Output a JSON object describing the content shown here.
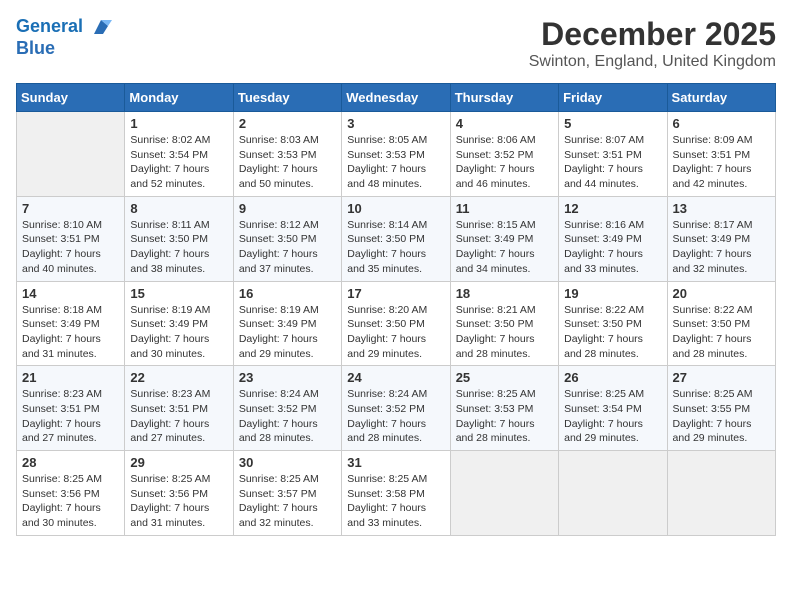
{
  "header": {
    "logo_line1": "General",
    "logo_line2": "Blue",
    "month": "December 2025",
    "location": "Swinton, England, United Kingdom"
  },
  "weekdays": [
    "Sunday",
    "Monday",
    "Tuesday",
    "Wednesday",
    "Thursday",
    "Friday",
    "Saturday"
  ],
  "weeks": [
    [
      {
        "day": "",
        "info": ""
      },
      {
        "day": "1",
        "info": "Sunrise: 8:02 AM\nSunset: 3:54 PM\nDaylight: 7 hours\nand 52 minutes."
      },
      {
        "day": "2",
        "info": "Sunrise: 8:03 AM\nSunset: 3:53 PM\nDaylight: 7 hours\nand 50 minutes."
      },
      {
        "day": "3",
        "info": "Sunrise: 8:05 AM\nSunset: 3:53 PM\nDaylight: 7 hours\nand 48 minutes."
      },
      {
        "day": "4",
        "info": "Sunrise: 8:06 AM\nSunset: 3:52 PM\nDaylight: 7 hours\nand 46 minutes."
      },
      {
        "day": "5",
        "info": "Sunrise: 8:07 AM\nSunset: 3:51 PM\nDaylight: 7 hours\nand 44 minutes."
      },
      {
        "day": "6",
        "info": "Sunrise: 8:09 AM\nSunset: 3:51 PM\nDaylight: 7 hours\nand 42 minutes."
      }
    ],
    [
      {
        "day": "7",
        "info": "Sunrise: 8:10 AM\nSunset: 3:51 PM\nDaylight: 7 hours\nand 40 minutes."
      },
      {
        "day": "8",
        "info": "Sunrise: 8:11 AM\nSunset: 3:50 PM\nDaylight: 7 hours\nand 38 minutes."
      },
      {
        "day": "9",
        "info": "Sunrise: 8:12 AM\nSunset: 3:50 PM\nDaylight: 7 hours\nand 37 minutes."
      },
      {
        "day": "10",
        "info": "Sunrise: 8:14 AM\nSunset: 3:50 PM\nDaylight: 7 hours\nand 35 minutes."
      },
      {
        "day": "11",
        "info": "Sunrise: 8:15 AM\nSunset: 3:49 PM\nDaylight: 7 hours\nand 34 minutes."
      },
      {
        "day": "12",
        "info": "Sunrise: 8:16 AM\nSunset: 3:49 PM\nDaylight: 7 hours\nand 33 minutes."
      },
      {
        "day": "13",
        "info": "Sunrise: 8:17 AM\nSunset: 3:49 PM\nDaylight: 7 hours\nand 32 minutes."
      }
    ],
    [
      {
        "day": "14",
        "info": "Sunrise: 8:18 AM\nSunset: 3:49 PM\nDaylight: 7 hours\nand 31 minutes."
      },
      {
        "day": "15",
        "info": "Sunrise: 8:19 AM\nSunset: 3:49 PM\nDaylight: 7 hours\nand 30 minutes."
      },
      {
        "day": "16",
        "info": "Sunrise: 8:19 AM\nSunset: 3:49 PM\nDaylight: 7 hours\nand 29 minutes."
      },
      {
        "day": "17",
        "info": "Sunrise: 8:20 AM\nSunset: 3:50 PM\nDaylight: 7 hours\nand 29 minutes."
      },
      {
        "day": "18",
        "info": "Sunrise: 8:21 AM\nSunset: 3:50 PM\nDaylight: 7 hours\nand 28 minutes."
      },
      {
        "day": "19",
        "info": "Sunrise: 8:22 AM\nSunset: 3:50 PM\nDaylight: 7 hours\nand 28 minutes."
      },
      {
        "day": "20",
        "info": "Sunrise: 8:22 AM\nSunset: 3:50 PM\nDaylight: 7 hours\nand 28 minutes."
      }
    ],
    [
      {
        "day": "21",
        "info": "Sunrise: 8:23 AM\nSunset: 3:51 PM\nDaylight: 7 hours\nand 27 minutes."
      },
      {
        "day": "22",
        "info": "Sunrise: 8:23 AM\nSunset: 3:51 PM\nDaylight: 7 hours\nand 27 minutes."
      },
      {
        "day": "23",
        "info": "Sunrise: 8:24 AM\nSunset: 3:52 PM\nDaylight: 7 hours\nand 28 minutes."
      },
      {
        "day": "24",
        "info": "Sunrise: 8:24 AM\nSunset: 3:52 PM\nDaylight: 7 hours\nand 28 minutes."
      },
      {
        "day": "25",
        "info": "Sunrise: 8:25 AM\nSunset: 3:53 PM\nDaylight: 7 hours\nand 28 minutes."
      },
      {
        "day": "26",
        "info": "Sunrise: 8:25 AM\nSunset: 3:54 PM\nDaylight: 7 hours\nand 29 minutes."
      },
      {
        "day": "27",
        "info": "Sunrise: 8:25 AM\nSunset: 3:55 PM\nDaylight: 7 hours\nand 29 minutes."
      }
    ],
    [
      {
        "day": "28",
        "info": "Sunrise: 8:25 AM\nSunset: 3:56 PM\nDaylight: 7 hours\nand 30 minutes."
      },
      {
        "day": "29",
        "info": "Sunrise: 8:25 AM\nSunset: 3:56 PM\nDaylight: 7 hours\nand 31 minutes."
      },
      {
        "day": "30",
        "info": "Sunrise: 8:25 AM\nSunset: 3:57 PM\nDaylight: 7 hours\nand 32 minutes."
      },
      {
        "day": "31",
        "info": "Sunrise: 8:25 AM\nSunset: 3:58 PM\nDaylight: 7 hours\nand 33 minutes."
      },
      {
        "day": "",
        "info": ""
      },
      {
        "day": "",
        "info": ""
      },
      {
        "day": "",
        "info": ""
      }
    ]
  ]
}
